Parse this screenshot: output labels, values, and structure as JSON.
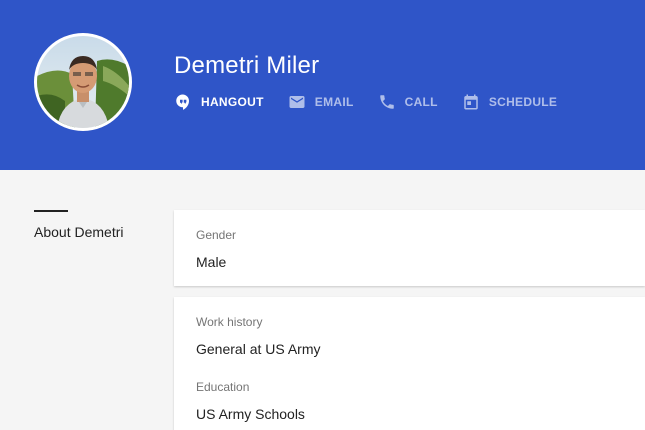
{
  "profile": {
    "name": "Demetri Miler",
    "avatar_alt": "profile photo"
  },
  "actions": [
    {
      "label": "HANGOUT",
      "icon": "hangout-icon",
      "active": true
    },
    {
      "label": "EMAIL",
      "icon": "email-icon",
      "active": false
    },
    {
      "label": "CALL",
      "icon": "phone-icon",
      "active": false
    },
    {
      "label": "SCHEDULE",
      "icon": "calendar-icon",
      "active": false
    }
  ],
  "about": {
    "section_label": "About Demetri",
    "gender": {
      "label": "Gender",
      "value": "Male"
    },
    "work_history": {
      "label": "Work history",
      "value": "General at US Army"
    },
    "education": {
      "label": "Education",
      "value": "US Army Schools"
    }
  },
  "colors": {
    "header_bg": "#2f55c8",
    "page_bg": "#f5f5f5",
    "card_bg": "#ffffff"
  }
}
